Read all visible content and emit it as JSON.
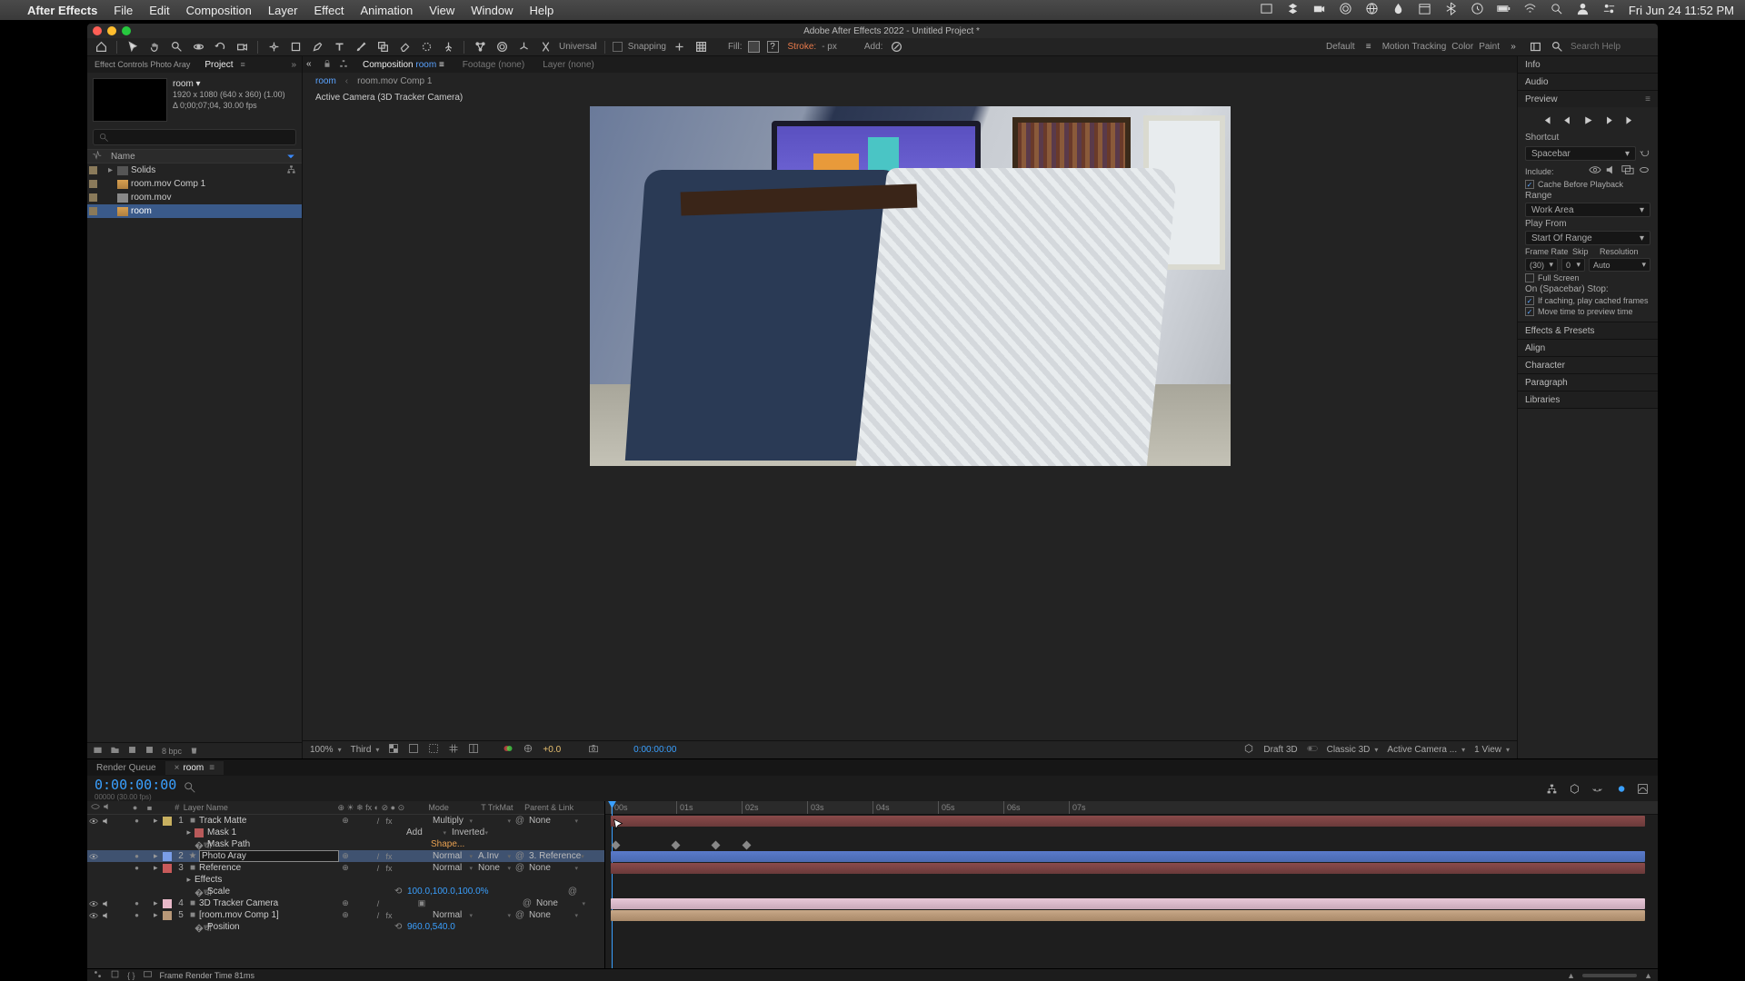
{
  "menubar": {
    "app": "After Effects",
    "items": [
      "File",
      "Edit",
      "Composition",
      "Layer",
      "Effect",
      "Animation",
      "View",
      "Window",
      "Help"
    ],
    "clock": "Fri Jun 24  11:52 PM"
  },
  "window": {
    "title": "Adobe After Effects 2022 - Untitled Project *"
  },
  "toolbar": {
    "snapping": "Snapping",
    "fill": "Fill:",
    "stroke": "Stroke:",
    "strokepx": "- px",
    "add": "Add:",
    "default": "Default",
    "motiontracking": "Motion Tracking",
    "color": "Color",
    "paint": "Paint",
    "search_ph": "Search Help"
  },
  "project": {
    "tab_fx": "Effect Controls Photo Aray",
    "tab_proj": "Project",
    "comp_name": "room ▾",
    "res": "1920 x 1080  (640 x 360) (1.00)",
    "dur": "Δ 0;00;07;04, 30.00 fps",
    "colhead": "Name",
    "items": [
      {
        "type": "folder",
        "name": "Solids",
        "tw": "▸"
      },
      {
        "type": "comp",
        "name": "room.mov Comp 1",
        "tw": ""
      },
      {
        "type": "mov",
        "name": "room.mov",
        "tw": ""
      },
      {
        "type": "comp",
        "name": "room",
        "tw": "",
        "sel": true
      }
    ],
    "bpc": "8 bpc"
  },
  "comp": {
    "tab_comp": "Composition",
    "tab_comp_name": "room",
    "tab_footage": "Footage (none)",
    "tab_layer": "Layer (none)",
    "flow_cur": "room",
    "flow_next": "room.mov Comp 1",
    "activecam": "Active Camera (3D Tracker Camera)"
  },
  "viewfoot": {
    "zoom": "100%",
    "res": "Third",
    "exposure": "+0.0",
    "tc": "0:00:00:00",
    "draft": "Draft 3D",
    "renderer": "Classic 3D",
    "camera": "Active Camera ...",
    "views": "1 View"
  },
  "right": {
    "info": "Info",
    "audio": "Audio",
    "preview": "Preview",
    "shortcut_lbl": "Shortcut",
    "shortcut": "Spacebar",
    "include": "Include:",
    "cache": "Cache Before Playback",
    "range_lbl": "Range",
    "range": "Work Area",
    "playfrom_lbl": "Play From",
    "playfrom": "Start Of Range",
    "fr_lbl": "Frame Rate",
    "skip_lbl": "Skip",
    "res_lbl": "Resolution",
    "fr": "(30)",
    "skip": "0",
    "res": "Auto",
    "fullscreen": "Full Screen",
    "stop_lbl": "On (Spacebar) Stop:",
    "ifcache": "If caching, play cached frames",
    "movetime": "Move time to preview time",
    "panels": [
      "Effects & Presets",
      "Align",
      "Character",
      "Paragraph",
      "Libraries"
    ]
  },
  "timeline": {
    "tab_rq": "Render Queue",
    "tab_comp": "room",
    "tab_x": "≡",
    "tc": "0:00:00:00",
    "tcsub": "00000 (30.00 fps)",
    "head": {
      "num": "#",
      "name": "Layer Name",
      "mode": "Mode",
      "trk": "T  TrkMat",
      "par": "Parent & Link"
    },
    "kf_row": "Mask Path",
    "kf_shape": "Shape...",
    "layers": [
      {
        "n": "1",
        "clr": "#c8b060",
        "name": "Track Matte",
        "mode": "Multiply",
        "trk": "",
        "par": "None",
        "eye": true,
        "snd": true
      },
      {
        "sub": 1,
        "name": "Mask 1",
        "mode": "Add",
        "trk": "Inverted",
        "clr": "#b85a5a"
      },
      {
        "sub": 2,
        "name": "Mask Path",
        "shape": "Shape..."
      },
      {
        "n": "2",
        "clr": "#7a9ee8",
        "name": "Photo Aray",
        "mode": "Normal",
        "trk": "A.Inv",
        "par": "3. Reference",
        "sel": true,
        "eye": true
      },
      {
        "n": "3",
        "clr": "#c85a5a",
        "name": "Reference",
        "mode": "Normal",
        "trk": "None",
        "par": "None"
      },
      {
        "sub": 1,
        "name": "Effects"
      },
      {
        "sub": 2,
        "name": "Scale",
        "val": "100.0,100.0,100.0%",
        "link": true
      },
      {
        "n": "4",
        "clr": "#e8b8c8",
        "name": "3D Tracker Camera",
        "par": "None",
        "eye": true,
        "snd": true
      },
      {
        "n": "5",
        "clr": "#b89878",
        "name": "[room.mov Comp 1]",
        "mode": "Normal",
        "trk": "",
        "par": "None",
        "eye": true,
        "snd": true
      },
      {
        "sub": 2,
        "name": "Position",
        "val": "960.0,540.0"
      }
    ],
    "ruler": [
      "00s",
      "01s",
      "02s",
      "03s",
      "04s",
      "05s",
      "06s",
      "07s"
    ],
    "frametime": "Frame Render Time  81ms"
  }
}
